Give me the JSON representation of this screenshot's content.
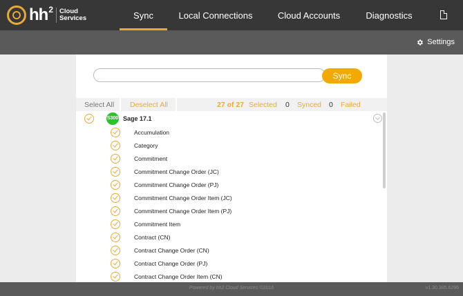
{
  "app": {
    "logo_hh": "hh",
    "logo_sup": "2",
    "logo_line1": "Cloud",
    "logo_line2": "Services"
  },
  "tabs": [
    {
      "label": "Sync",
      "active": true
    },
    {
      "label": "Local Connections",
      "active": false
    },
    {
      "label": "Cloud Accounts",
      "active": false
    },
    {
      "label": "Diagnostics",
      "active": false
    }
  ],
  "toolbar": {
    "settings_label": "Settings"
  },
  "search": {
    "value": "",
    "placeholder": ""
  },
  "sync_button": "Sync",
  "status": {
    "select_all": "Select All",
    "deselect_all": "Deselect All",
    "selected_count": "27 of 27",
    "selected_label": "Selected",
    "synced_count": "0",
    "synced_label": "Synced",
    "failed_count": "0",
    "failed_label": "Failed"
  },
  "source": {
    "badge": "S300",
    "name": "Sage 17.1"
  },
  "items": [
    "Accumulation",
    "Category",
    "Commitment",
    "Commitment Change Order (JC)",
    "Commitment Change Order (PJ)",
    "Commitment Change Order Item (JC)",
    "Commitment Change Order Item (PJ)",
    "Commitment Item",
    "Contract (CN)",
    "Contract Change Order (CN)",
    "Contract Change Order (PJ)",
    "Contract Change Order Item (CN)"
  ],
  "footer": {
    "powered_by": "Powered by hh2 Cloud Services ©2016",
    "version": "v1.30.385.6296"
  },
  "colors": {
    "accent": "#e8a93a",
    "button": "#f2a900",
    "topbar": "#373737",
    "subbar": "#5a5a5a",
    "badge": "#2ac32a"
  }
}
